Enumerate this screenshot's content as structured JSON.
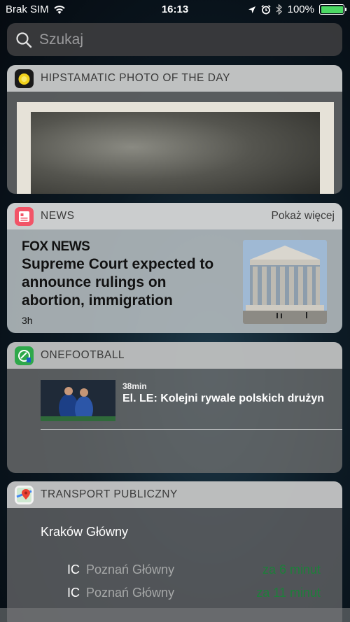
{
  "status": {
    "carrier": "Brak SIM",
    "time": "16:13",
    "battery": "100%",
    "battery_level": 1.0
  },
  "search": {
    "placeholder": "Szukaj",
    "icon": "search-icon"
  },
  "widgets": {
    "hipstamatic": {
      "title": "HIPSTAMATIC PHOTO OF THE DAY"
    },
    "news": {
      "title": "NEWS",
      "more": "Pokaż więcej",
      "source": "FOX NEWS",
      "headline": "Supreme Court expected to announce rulings on abortion, immigration",
      "age": "3h"
    },
    "onefootball": {
      "title": "ONEFOOTBALL",
      "time": "38min",
      "headline": "El. LE: Kolejni rywale polskich drużyn"
    },
    "transport": {
      "title": "TRANSPORT PUBLICZNY",
      "station": "Kraków Główny",
      "departures": [
        {
          "type": "IC",
          "destination": "Poznań Główny",
          "eta": "za 6 minut"
        },
        {
          "type": "IC",
          "destination": "Poznań Główny",
          "eta": "za 11 minut"
        }
      ]
    }
  },
  "colors": {
    "battery_green": "#4cd964",
    "eta_green": "#1d7f3a"
  }
}
